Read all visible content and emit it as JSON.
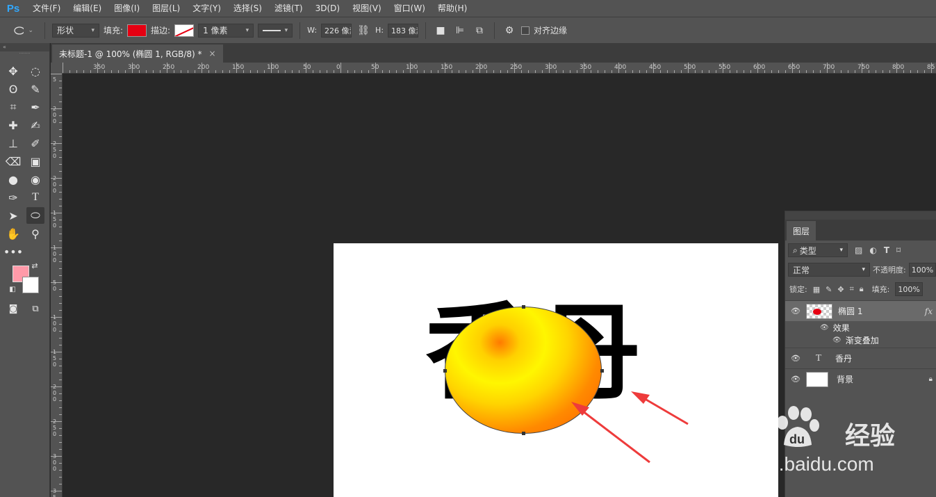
{
  "app": {
    "logo": "Ps"
  },
  "menu": [
    "文件(F)",
    "编辑(E)",
    "图像(I)",
    "图层(L)",
    "文字(Y)",
    "选择(S)",
    "滤镜(T)",
    "3D(D)",
    "视图(V)",
    "窗口(W)",
    "帮助(H)"
  ],
  "options": {
    "shape_mode": "形状",
    "fill_label": "填充:",
    "stroke_label": "描边:",
    "stroke_width": "1 像素",
    "w_label": "W:",
    "w_value": "226 像素",
    "h_label": "H:",
    "h_value": "183 像素",
    "align_edges_label": "对齐边缘",
    "fill_color": "#e60012"
  },
  "document_tab": {
    "title": "未标题-1 @ 100% (椭圆 1, RGB/8) *",
    "close": "×"
  },
  "ruler_top": [
    "350",
    "300",
    "250",
    "200",
    "150",
    "100",
    "50",
    "0",
    "50",
    "100",
    "150",
    "200",
    "250",
    "300",
    "350",
    "400",
    "450",
    "500",
    "550",
    "600",
    "650",
    "700",
    "750",
    "800",
    "85"
  ],
  "ruler_left": [
    "5",
    "2 0 0",
    "2 5 0",
    "2 0 0",
    "1 5 0",
    "1 0 0",
    "5 0",
    "0",
    "5 0",
    "1 0 0",
    "1 5 0",
    "2 0 0",
    "2 5 0",
    "3 0 0",
    "3 5"
  ],
  "canvas": {
    "text": "香丹"
  },
  "colors": {
    "foreground": "#ff9aa9",
    "background": "#ffffff"
  },
  "layers_panel": {
    "tab": "图层",
    "filter_kind": "类型",
    "blend_mode": "正常",
    "opacity_label": "不透明度:",
    "opacity_value": "100%",
    "lock_label": "锁定:",
    "fill_label": "填充:",
    "fill_value": "100%",
    "layers": [
      {
        "name": "椭圆 1",
        "fx": "fx",
        "effects_label": "效果",
        "effect": "渐变叠加"
      },
      {
        "name": "香丹",
        "type_icon": "T"
      },
      {
        "name": "背景"
      }
    ]
  },
  "watermark": {
    "brand_left": "Bai",
    "brand_right": "经验",
    "site": "jingyan.baidu.com"
  }
}
